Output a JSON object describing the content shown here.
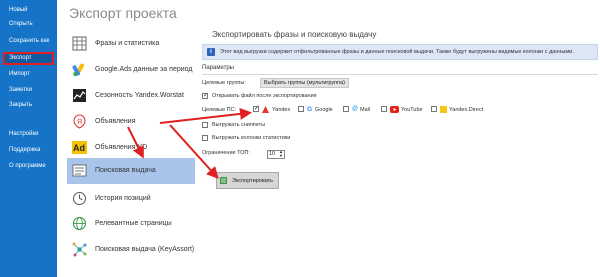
{
  "sidebar": {
    "items": [
      {
        "label": "Новый"
      },
      {
        "label": "Открыть"
      },
      {
        "label": "Сохранить как"
      },
      {
        "label": "Экспорт"
      },
      {
        "label": "Импорт"
      },
      {
        "label": "Заметки"
      },
      {
        "label": "Закрыть"
      },
      {
        "label": "Настройки"
      },
      {
        "label": "Поддержка"
      },
      {
        "label": "О программе"
      }
    ],
    "accent": "#1573c8",
    "highlight_color": "#e02020"
  },
  "page_title": "Экспорт проекта",
  "export_types": [
    {
      "label": "Фразы и статистика",
      "icon": "phrases-grid-icon"
    },
    {
      "label": "Google.Ads данные за период",
      "icon": "google-ads-icon"
    },
    {
      "label": "Сезонность Yandex.Worstat",
      "icon": "seasonality-chart-icon"
    },
    {
      "label": "Объявления",
      "icon": "yandex-ads-icon"
    },
    {
      "label": "Объявления YD",
      "icon": "ad-yd-icon"
    },
    {
      "label": "Поисковая выдача",
      "icon": "search-results-icon",
      "selected": true
    },
    {
      "label": "История позиций",
      "icon": "position-history-icon"
    },
    {
      "label": "Релевантные страницы",
      "icon": "relevant-pages-icon"
    },
    {
      "label": "Поисковая выдача (KeyAssort)",
      "icon": "keyassort-network-icon"
    }
  ],
  "panel": {
    "title": "Экспортировать фразы и поисковую выдачу",
    "info_text": "Этот вид выгрузки содержит отфильтрованные фразы и данные поисковой выдачи. Также будут выгружены видимые колонки с данными.",
    "params_label": "Параметры",
    "target_groups_label": "Целевые группы:",
    "groups_button": "Выбрать группы (мультигруппа)",
    "open_file_label": "Открывать файл после экспортирования",
    "open_file_checked": true,
    "target_ps_label": "Целевые ПС:",
    "search_engines": [
      {
        "label": "Yandex",
        "checked": true,
        "icon": "yandex-icon",
        "color": "#e8332d"
      },
      {
        "label": "Google",
        "checked": false,
        "icon": "google-icon",
        "color": "#4285f4"
      },
      {
        "label": "Mail",
        "checked": false,
        "icon": "mail-icon",
        "color": "#168de2"
      },
      {
        "label": "YouTube",
        "checked": false,
        "icon": "youtube-icon",
        "color": "#e62117"
      },
      {
        "label": "Yandex.Direct",
        "checked": false,
        "icon": "yandex-direct-icon",
        "color": "#f5c518"
      }
    ],
    "snippets_label": "Выгружать сниппеты",
    "snippets_checked": false,
    "stats_cols_label": "Выгружать колонки статистики",
    "stats_cols_checked": false,
    "limit_label": "Ограничение ТОП:",
    "limit_value": "10",
    "export_button": "Экспортировать"
  },
  "annotation_color": "#e02020"
}
